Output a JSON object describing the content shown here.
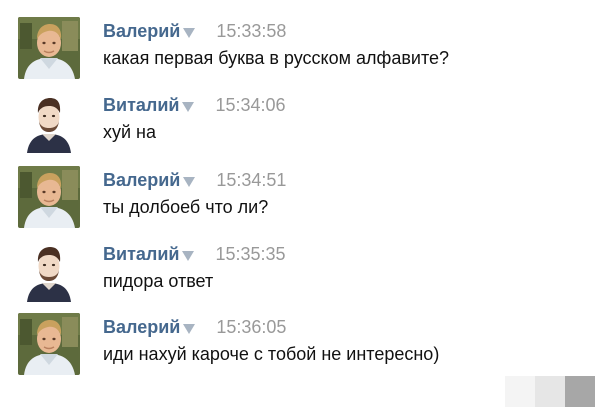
{
  "colors": {
    "author_link": "#45688e",
    "timestamp": "#999999",
    "message_text": "#111111",
    "caret": "#a8b4c2"
  },
  "messages": [
    {
      "author": "Валерий",
      "avatar": "avatar-valeriy",
      "time": "15:33:58",
      "text": "какая первая буква в русском алфавите?"
    },
    {
      "author": "Виталий",
      "avatar": "avatar-vitaliy",
      "time": "15:34:06",
      "text": "хуй на"
    },
    {
      "author": "Валерий",
      "avatar": "avatar-valeriy",
      "time": "15:34:51",
      "text": "ты долбоеб что ли?"
    },
    {
      "author": "Виталий",
      "avatar": "avatar-vitaliy",
      "time": "15:35:35",
      "text": "пидора ответ"
    },
    {
      "author": "Валерий",
      "avatar": "avatar-valeriy",
      "time": "15:36:05",
      "text": "иди нахуй кароче с тобой не интересно)"
    }
  ],
  "watermark_squares": [
    "#f4f4f4",
    "#e6e6e6",
    "#a7a7a7"
  ]
}
